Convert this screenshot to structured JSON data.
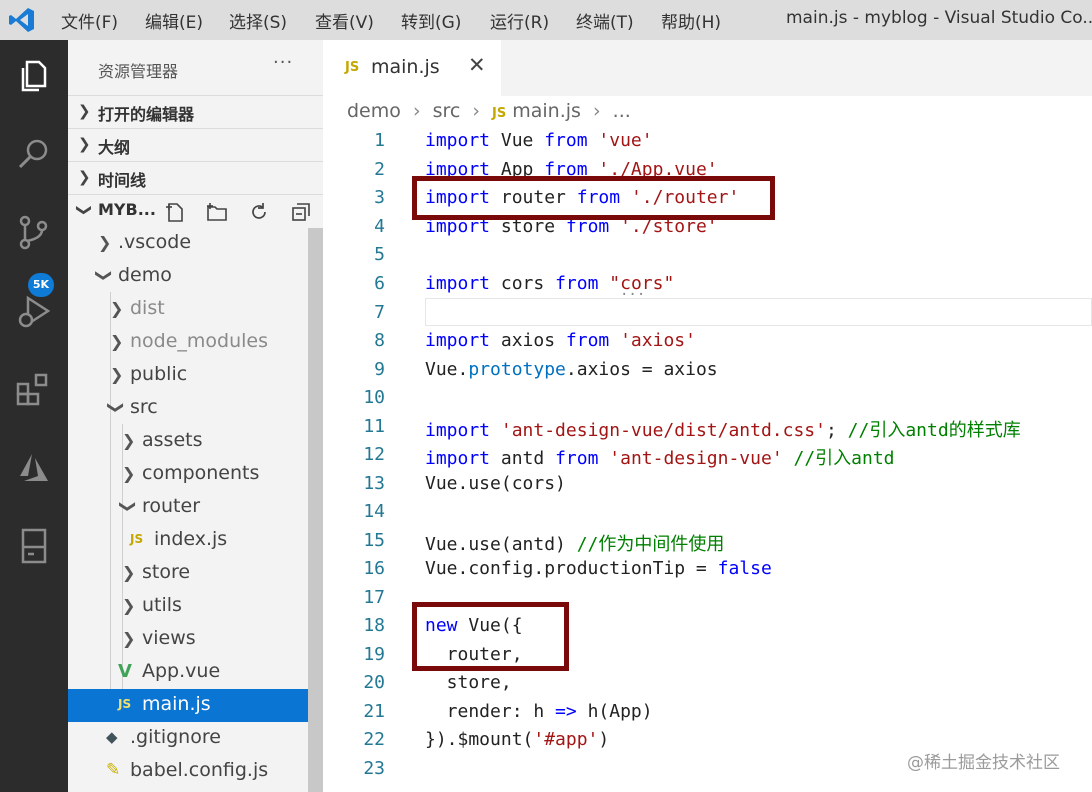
{
  "titlebar": {
    "menu": [
      {
        "label": "文件(F)"
      },
      {
        "label": "编辑(E)"
      },
      {
        "label": "选择(S)"
      },
      {
        "label": "查看(V)"
      },
      {
        "label": "转到(G)"
      },
      {
        "label": "运行(R)"
      },
      {
        "label": "终端(T)"
      },
      {
        "label": "帮助(H)"
      }
    ],
    "window_title": "main.js - myblog - Visual Studio Co..."
  },
  "activitybar": {
    "icons": [
      "explorer-icon",
      "search-icon",
      "source-control-icon",
      "run-debug-icon",
      "extensions-icon",
      "azure-icon",
      "remote-explorer-icon"
    ],
    "scm_badge": "5K",
    "colors": {
      "background": "#2c2c2c",
      "badge": "#0e7bd6"
    }
  },
  "sidebar": {
    "title": "资源管理器",
    "more": "···",
    "sections": [
      {
        "label": "打开的编辑器"
      },
      {
        "label": "大纲"
      },
      {
        "label": "时间线"
      },
      {
        "label": "MYB..."
      }
    ],
    "tree": [
      {
        "name": ".vscode",
        "kind": "folder"
      },
      {
        "name": "demo",
        "kind": "folder-open"
      },
      {
        "name": "dist",
        "kind": "folder"
      },
      {
        "name": "node_modules",
        "kind": "folder"
      },
      {
        "name": "public",
        "kind": "folder"
      },
      {
        "name": "src",
        "kind": "folder-open"
      },
      {
        "name": "assets",
        "kind": "folder"
      },
      {
        "name": "components",
        "kind": "folder"
      },
      {
        "name": "router",
        "kind": "folder-open"
      },
      {
        "name": "index.js",
        "kind": "js",
        "icon": "JS"
      },
      {
        "name": "store",
        "kind": "folder"
      },
      {
        "name": "utils",
        "kind": "folder"
      },
      {
        "name": "views",
        "kind": "folder"
      },
      {
        "name": "App.vue",
        "kind": "vue",
        "icon": "V"
      },
      {
        "name": "main.js",
        "kind": "js",
        "icon": "JS",
        "selected": true
      },
      {
        "name": ".gitignore",
        "kind": "git",
        "icon": "◆"
      },
      {
        "name": "babel.config.js",
        "kind": "babel",
        "icon": "✎"
      }
    ]
  },
  "editor": {
    "tab": {
      "icon": "JS",
      "label": "main.js",
      "close": "✕"
    },
    "breadcrumb": [
      "demo",
      "src",
      "main.js",
      "..."
    ],
    "breadcrumb_sep": "›",
    "lines": [
      {
        "no": "1"
      },
      {
        "no": "2"
      },
      {
        "no": "3"
      },
      {
        "no": "4"
      },
      {
        "no": "5"
      },
      {
        "no": "6"
      },
      {
        "no": "7"
      },
      {
        "no": "8"
      },
      {
        "no": "9"
      },
      {
        "no": "10"
      },
      {
        "no": "11"
      },
      {
        "no": "12"
      },
      {
        "no": "13"
      },
      {
        "no": "14"
      },
      {
        "no": "15"
      },
      {
        "no": "16"
      },
      {
        "no": "17"
      },
      {
        "no": "18"
      },
      {
        "no": "19"
      },
      {
        "no": "20"
      },
      {
        "no": "21"
      },
      {
        "no": "22"
      },
      {
        "no": "23"
      }
    ],
    "code": {
      "l1": [
        "import",
        " Vue ",
        "from",
        " ",
        "'vue'"
      ],
      "l2": [
        "import",
        " App ",
        "from",
        " ",
        "'./App.vue'"
      ],
      "l3": [
        "import",
        " router ",
        "from",
        " ",
        "'./router'"
      ],
      "l4": [
        "import",
        " store ",
        "from",
        " ",
        "'./store'"
      ],
      "l6": [
        "import",
        " cors ",
        "from",
        " ",
        "\"cors\""
      ],
      "l8": [
        "import",
        " axios ",
        "from",
        " ",
        "'axios'"
      ],
      "l9": [
        "Vue.",
        "prototype",
        ".axios = axios"
      ],
      "l11": [
        "import",
        " ",
        "'ant-design-vue/dist/antd.css'",
        "; ",
        "//引入antd的样式库"
      ],
      "l12": [
        "import",
        " antd ",
        "from",
        " ",
        "'ant-design-vue'",
        " ",
        "//引入antd"
      ],
      "l13": [
        "Vue.use(cors)"
      ],
      "l15": [
        "Vue.use(antd) ",
        "//作为中间件使用"
      ],
      "l16": [
        "Vue.config.productionTip = ",
        "false"
      ],
      "l18": [
        "new",
        " Vue({"
      ],
      "l19": [
        "  router,"
      ],
      "l20": [
        "  store,"
      ],
      "l21": [
        "  render: h ",
        "=>",
        " h(App)"
      ],
      "l22": [
        "}).$mount(",
        "'#app'",
        ")"
      ]
    },
    "overflow_dots": "...",
    "highlight_color": "#7a0a0a"
  },
  "watermark": "@稀土掘金技术社区"
}
